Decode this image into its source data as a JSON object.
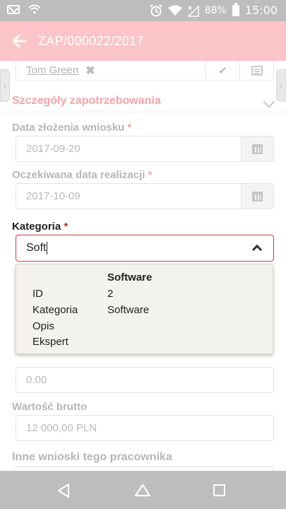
{
  "status_bar": {
    "battery": "88%",
    "time": "15:00",
    "icons": [
      "mail-icon",
      "wifi-icon",
      "alarm-icon",
      "wifi-icon",
      "signal-icon",
      "battery-icon"
    ]
  },
  "app_bar": {
    "title": "ZAP/000022/2017",
    "background": "#fbc4c8"
  },
  "assignee": {
    "name": "Tom Green"
  },
  "section": {
    "title": "Szczegóły zapotrzebowania"
  },
  "fields": {
    "submission_date": {
      "label": "Data złożenia wniosku",
      "required": "*",
      "value": "2017-09-20"
    },
    "expected_date": {
      "label": "Oczekiwana data realizacji",
      "required": "*",
      "value": "2017-10-09"
    },
    "category": {
      "label": "Kategoria",
      "required": "*",
      "value": "Soft"
    },
    "net_value": {
      "value": "0.00"
    },
    "gross_value": {
      "label": "Wartość brutto",
      "value": "12 000,00 PLN"
    }
  },
  "dropdown": {
    "header": "Software",
    "rows": [
      {
        "label": "ID",
        "value": "2"
      },
      {
        "label": "Kategoria",
        "value": "Software"
      },
      {
        "label": "Opis",
        "value": ""
      },
      {
        "label": "Ekspert",
        "value": ""
      }
    ]
  },
  "other_requests": {
    "title": "Inne wnioski tego pracownika"
  },
  "colors": {
    "accent": "#f4a4aa",
    "error_border": "#cc3a42",
    "required": "#d5232f"
  }
}
